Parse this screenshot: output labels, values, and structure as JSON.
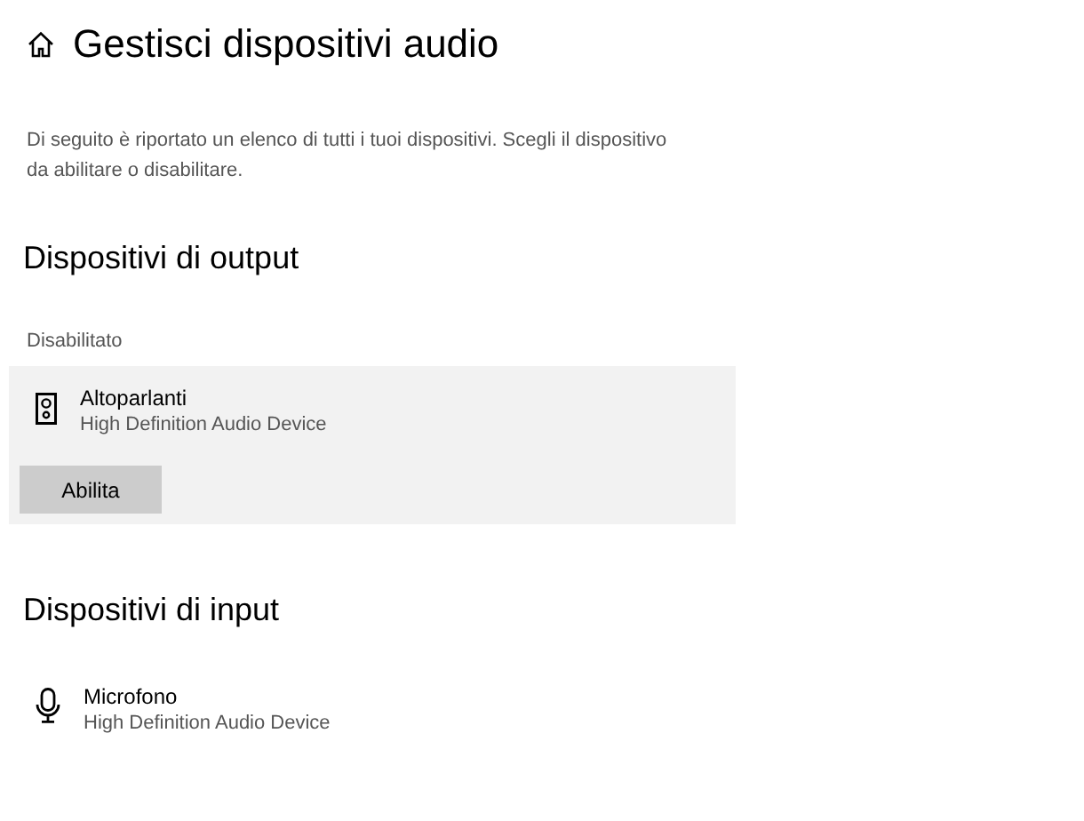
{
  "title": "Gestisci dispositivi audio",
  "description": "Di seguito è riportato un elenco di tutti i tuoi dispositivi. Scegli il dispositivo da abilitare o disabilitare.",
  "sections": [
    {
      "heading": "Dispositivi di output",
      "group_label": "Disabilitato",
      "devices": [
        {
          "kind": "speaker",
          "name": "Altoparlanti",
          "subtitle": "High Definition Audio Device",
          "selected": true,
          "button": "Abilita"
        }
      ]
    },
    {
      "heading": "Dispositivi di input",
      "devices": [
        {
          "kind": "microphone",
          "name": "Microfono",
          "subtitle": "High Definition Audio Device",
          "selected": false
        }
      ]
    }
  ]
}
